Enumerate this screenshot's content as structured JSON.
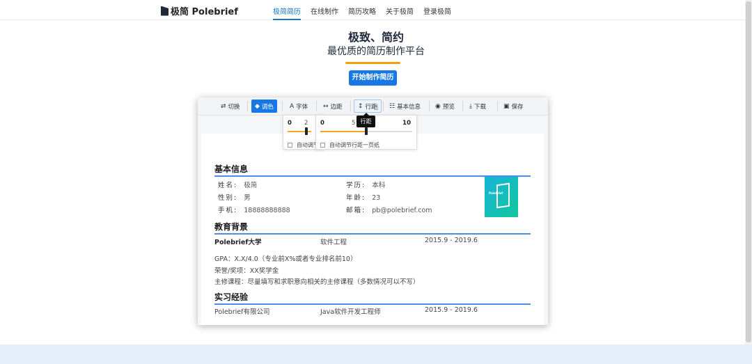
{
  "nav": {
    "brand": "极简 Polebrief",
    "links": [
      "极简简历",
      "在线制作",
      "简历攻略",
      "关于极简",
      "登录极简"
    ],
    "active_index": 0
  },
  "hero": {
    "title": "极致、简约",
    "subtitle": "最优质的简历制作平台",
    "cta": "开始制作简历"
  },
  "toolbar": {
    "buttons": [
      {
        "icon": "⇄",
        "label": "切换"
      },
      {
        "icon": "◆",
        "label": "调色"
      },
      {
        "icon": "A",
        "label": "字体"
      },
      {
        "icon": "↔",
        "label": "边距"
      },
      {
        "icon": "↕",
        "label": "行距"
      },
      {
        "icon": "☷",
        "label": "基本信息"
      },
      {
        "icon": "◉",
        "label": "预览"
      },
      {
        "icon": "⤓",
        "label": "下载"
      },
      {
        "icon": "▣",
        "label": "保存"
      }
    ],
    "active_label": "调色",
    "hover_label": "行距",
    "tooltip": "行距"
  },
  "margin_dropdown": {
    "min": "0",
    "value": "2",
    "auto_label": "自动调节"
  },
  "linespacing_dropdown": {
    "min": "0",
    "mid": "5",
    "max": "10",
    "value_fraction": 0.5,
    "auto_label": "自动调节行距一页纸"
  },
  "resume": {
    "basic": {
      "title": "基本信息",
      "name_label": "姓名:",
      "name": "极简",
      "gender_label": "性别:",
      "gender": "男",
      "phone_label": "手机:",
      "phone": "18888888888",
      "degree_label": "学历:",
      "degree": "本科",
      "age_label": "年龄:",
      "age": "23",
      "email_label": "邮箱:",
      "email": "pb@polebrief.com",
      "photo_text": "Polebrief"
    },
    "education": {
      "title": "教育背景",
      "school": "Polebrief大学",
      "major": "软件工程",
      "period": "2015.9 - 2019.6",
      "gpa": "GPA：X.X/4.0（专业前X%或者专业排名前10）",
      "honors": "荣誉/奖项：XX奖学金",
      "courses": "主修课程：尽量填写和求职意向相关的主修课程（多数情况可以不写）"
    },
    "internship": {
      "title": "实习经验",
      "company": "Polebrief有限公司",
      "role": "Java软件开发工程师",
      "period": "2015.9 - 2019.6"
    }
  }
}
